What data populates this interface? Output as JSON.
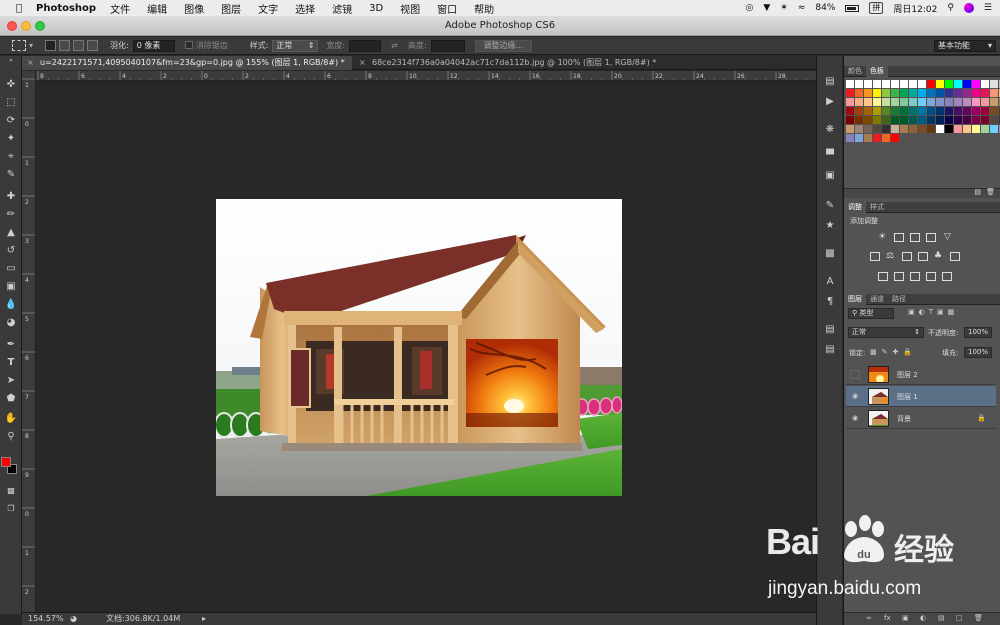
{
  "menubar": {
    "app": "Photoshop",
    "items": [
      "文件",
      "编辑",
      "图像",
      "图层",
      "文字",
      "选择",
      "滤镜",
      "3D",
      "视图",
      "窗口",
      "帮助"
    ],
    "battery": "84%",
    "ime": "拼",
    "clock": "周日12:02"
  },
  "window": {
    "title": "Adobe Photoshop CS6"
  },
  "options": {
    "feather_label": "羽化:",
    "feather_value": "0 像素",
    "antialias_label": "消除锯齿",
    "style_label": "样式:",
    "style_value": "正常",
    "width_label": "宽度:",
    "height_label": "高度:",
    "refine_edge_button": "调整边缘...",
    "workspace": "基本功能"
  },
  "tabs": [
    {
      "label": "u=2422171571,4095040107&fm=23&gp=0.jpg @ 155% (图层 1, RGB/8#) *",
      "close": "×"
    },
    {
      "label": "68ce2314f736a0a04042ac71c7da112b.jpg @ 100% (图层 1, RGB/8#) *",
      "close": "×"
    }
  ],
  "ruler": {
    "top": [
      "8",
      "6",
      "4",
      "2",
      "0",
      "2",
      "4",
      "6",
      "8",
      "10",
      "12",
      "14",
      "16",
      "18",
      "20",
      "22",
      "24",
      "26",
      "28"
    ],
    "left": [
      "1",
      "0",
      "1",
      "2",
      "3",
      "4",
      "5",
      "6",
      "7",
      "8",
      "9",
      "0",
      "1",
      "2"
    ]
  },
  "status": {
    "zoom": "154.57%",
    "doc": "文档:306.8K/1.04M"
  },
  "panels": {
    "color_tabs": [
      "颜色",
      "色板"
    ],
    "adjust_tabs": [
      "调整",
      "样式"
    ],
    "adjust_title": "添加调整",
    "layers_tabs": [
      "图层",
      "通道",
      "路径"
    ],
    "kind_filter": "类型",
    "blend_mode": "正常",
    "opacity_label": "不透明度:",
    "opacity_value": "100%",
    "lock_label": "锁定:",
    "fill_label": "填充:",
    "fill_value": "100%",
    "layers": [
      {
        "name": "图层 2",
        "visible": false,
        "active": false
      },
      {
        "name": "图层 1",
        "visible": true,
        "active": true
      },
      {
        "name": "背景",
        "visible": true,
        "active": false,
        "locked": true
      }
    ]
  },
  "colors": {
    "foreground": "#ff0000",
    "background": "#000000",
    "swatches": [
      "#ffffff",
      "#ffffff",
      "#ffffff",
      "#ffffff",
      "#ffffff",
      "#ffffff",
      "#ffffff",
      "#ffffff",
      "#ffffff",
      "#ff0000",
      "#ffff00",
      "#00ff00",
      "#00ffff",
      "#0000ff",
      "#ff00ff",
      "#ffffff",
      "#e0e0e0",
      "#c0c0c0",
      "#ed1c24",
      "#f26522",
      "#f7941d",
      "#fff200",
      "#8dc63f",
      "#39b54a",
      "#00a651",
      "#00a99d",
      "#00aeef",
      "#0072bc",
      "#0054a6",
      "#2e3192",
      "#662d91",
      "#92278f",
      "#ec008c",
      "#ed145b",
      "#f69679",
      "#fdc689",
      "#f6989d",
      "#f9ad81",
      "#fdc68a",
      "#fff799",
      "#c4df9b",
      "#a3d39c",
      "#82ca9c",
      "#7accc8",
      "#6dcff6",
      "#7da7d9",
      "#8393ca",
      "#8781bd",
      "#a186be",
      "#bd8cbf",
      "#f49ac1",
      "#f5989d",
      "#c69c6d",
      "#a67c52",
      "#9e0b0f",
      "#a0410d",
      "#a36209",
      "#aba000",
      "#598527",
      "#1a7b30",
      "#007236",
      "#00746b",
      "#0076a3",
      "#004b80",
      "#003471",
      "#1b1464",
      "#440e62",
      "#630460",
      "#9e005d",
      "#9e0039",
      "#754c24",
      "#603913",
      "#790000",
      "#7b2e00",
      "#7d4900",
      "#827b00",
      "#406618",
      "#005e20",
      "#005826",
      "#005952",
      "#005b7f",
      "#003663",
      "#002157",
      "#0d004c",
      "#32004b",
      "#4b0049",
      "#7b0046",
      "#7a0026",
      "#534741",
      "#362f2d",
      "#c69c6d",
      "#998675",
      "#736357",
      "#534741",
      "#362f2d",
      "#c7b299",
      "#a67c52",
      "#8c6239",
      "#754c24",
      "#603913",
      "#ffffff",
      "#000000",
      "#f5989d",
      "#fdc689",
      "#fff799",
      "#a3d39c",
      "#6dcff6",
      "#a186be",
      "#8781bd",
      "#7da7d9",
      "#a67c52",
      "#ed1c24",
      "#f26522",
      "#ff0000"
    ]
  },
  "watermark": {
    "brand_left": "Bai",
    "brand_right": "经验",
    "url": "jingyan.baidu.com"
  }
}
